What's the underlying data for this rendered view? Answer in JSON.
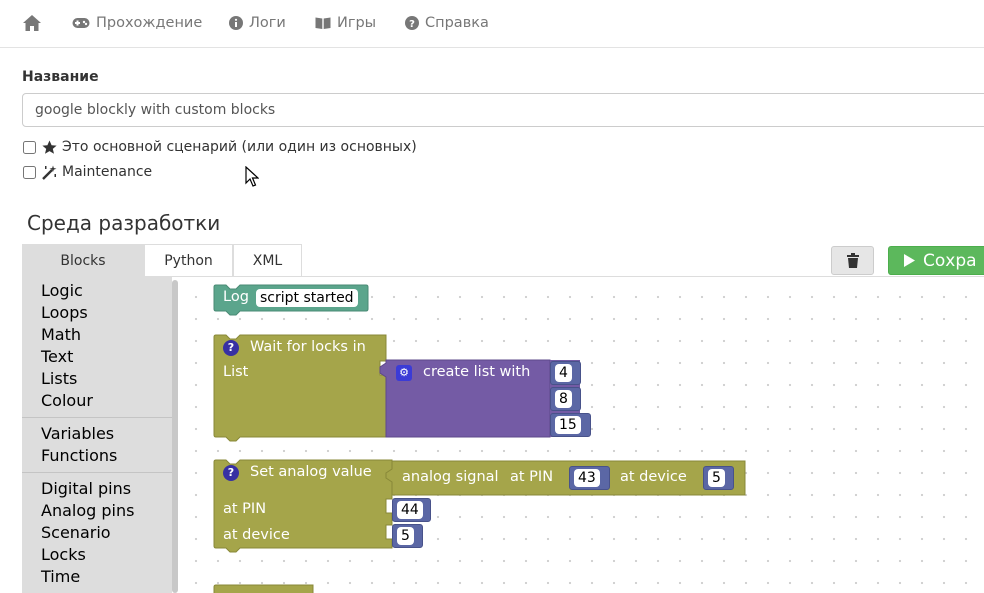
{
  "nav": {
    "home_icon": "home-icon",
    "items": [
      {
        "label": "Прохождение",
        "icon": "gamepad-icon"
      },
      {
        "label": "Логи",
        "icon": "info-icon"
      },
      {
        "label": "Игры",
        "icon": "book-icon"
      },
      {
        "label": "Справка",
        "icon": "question-icon"
      }
    ]
  },
  "form": {
    "name_label": "Название",
    "name_value": "google blockly with custom blocks",
    "main_scenario_label": "Это основной сценарий (или один из основных)",
    "maintenance_label": "Maintenance"
  },
  "editor": {
    "title": "Среда разработки",
    "tabs": [
      "Blocks",
      "Python",
      "XML"
    ],
    "active_tab": "Blocks",
    "save_label": "Сохра",
    "toolbox": {
      "group1": [
        "Logic",
        "Loops",
        "Math",
        "Text",
        "Lists",
        "Colour"
      ],
      "group2": [
        "Variables",
        "Functions"
      ],
      "group3": [
        "Digital pins",
        "Analog pins",
        "Scenario",
        "Locks",
        "Time"
      ]
    },
    "blocks": {
      "log": {
        "label": "Log",
        "text": "script started"
      },
      "wait": {
        "label": "Wait for locks in",
        "label2": "List",
        "list_label": "create list with",
        "items": [
          "4",
          "8",
          "15"
        ]
      },
      "analog": {
        "label": "Set analog value",
        "signal_label": "analog signal",
        "at_pin": "at PIN",
        "pin_value": "43",
        "at_device": "at device",
        "device_value": "5",
        "pin_label": "at PIN",
        "pin2": "44",
        "device_label": "at device",
        "device2": "5"
      }
    }
  },
  "colors": {
    "accent_green": "#5cb85c",
    "log_block": "#5ba58c",
    "action_block": "#a5a54a",
    "list_block": "#745ba5",
    "number_block": "#5b67a5"
  }
}
